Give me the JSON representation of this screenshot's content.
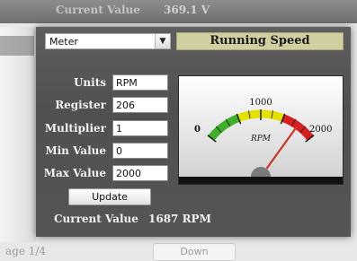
{
  "background": {
    "top_label": "Current Value",
    "top_value": "369.1 V",
    "page_text": "age 1/4",
    "down_label": "Down"
  },
  "dialog": {
    "type_select": {
      "value": "Meter"
    },
    "title": "Running Speed",
    "fields": {
      "units": {
        "label": "Units",
        "value": "RPM"
      },
      "register": {
        "label": "Register",
        "value": "206"
      },
      "multiplier": {
        "label": "Multiplier",
        "value": "1"
      },
      "min_value": {
        "label": "Min Value",
        "value": "0"
      },
      "max_value": {
        "label": "Max Value",
        "value": "2000"
      }
    },
    "update_label": "Update",
    "current_value_label": "Current Value",
    "current_value": "1687 RPM"
  },
  "gauge": {
    "min_label": "0",
    "mid_label": "1000",
    "max_label": "2000",
    "unit_label": "RPM",
    "min": 0,
    "max": 2000,
    "value": 1687,
    "colors": {
      "green": "#3fae2a",
      "yellow": "#e4e000",
      "red": "#d61f1f",
      "needle": "#c8352a"
    }
  }
}
